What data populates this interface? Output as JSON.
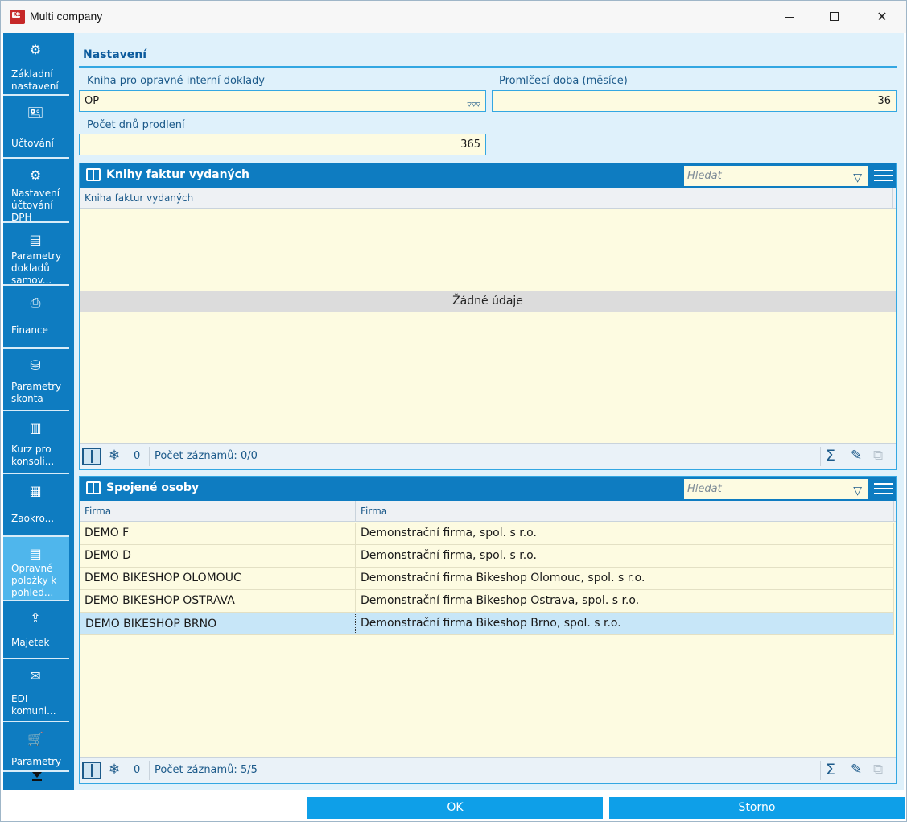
{
  "window": {
    "title": "Multi company",
    "app_icon": "K2"
  },
  "sidebar": {
    "items": [
      {
        "icon": "gear-icon",
        "glyph": "⚙",
        "label": "Základní nastavení"
      },
      {
        "icon": "accounting-icon",
        "glyph": "🖭",
        "label": "Účtování"
      },
      {
        "icon": "vat-settings-icon",
        "glyph": "⚙",
        "label": "Nastavení účtování DPH"
      },
      {
        "icon": "document-icon",
        "glyph": "▤",
        "label": "Parametry dokladů samov..."
      },
      {
        "icon": "printer-icon",
        "glyph": "⎙",
        "label": "Finance"
      },
      {
        "icon": "coins-icon",
        "glyph": "⛁",
        "label": "Parametry skonta"
      },
      {
        "icon": "chart-doc-icon",
        "glyph": "▥",
        "label": "Kurz pro konsoli..."
      },
      {
        "icon": "calculator-icon",
        "glyph": "▦",
        "label": "Zaokro..."
      },
      {
        "icon": "correction-doc-icon",
        "glyph": "▤",
        "label": "Opravné položky k pohled..."
      },
      {
        "icon": "asset-icon",
        "glyph": "⇪",
        "label": "Majetek"
      },
      {
        "icon": "mail-gear-icon",
        "glyph": "✉",
        "label": "EDI komuni..."
      },
      {
        "icon": "cart-icon",
        "glyph": "🛒",
        "label": "Parametry"
      }
    ]
  },
  "section": {
    "title": "Nastavení"
  },
  "form": {
    "book_label": "Kniha pro opravné interní doklady",
    "book_value": "OP",
    "period_label": "Promlčecí doba (měsíce)",
    "period_value": "36",
    "days_label": "Počet dnů prodlení",
    "days_value": "365"
  },
  "panel1": {
    "title": "Knihy faktur vydaných",
    "search_placeholder": "Hledat",
    "column": "Kniha faktur vydaných",
    "empty": "Žádné údaje",
    "count": "0",
    "records": "Počet záznamů: 0/0"
  },
  "panel2": {
    "title": "Spojené osoby",
    "search_placeholder": "Hledat",
    "columns": [
      "Firma",
      "Firma"
    ],
    "rows": [
      [
        "DEMO F",
        "Demonstrační firma, spol. s r.o."
      ],
      [
        "DEMO D",
        "Demonstrační firma, spol. s r.o."
      ],
      [
        "DEMO BIKESHOP OLOMOUC",
        "Demonstrační firma Bikeshop Olomouc, spol. s r.o."
      ],
      [
        "DEMO BIKESHOP OSTRAVA",
        "Demonstrační firma Bikeshop Ostrava, spol. s r.o."
      ],
      [
        "DEMO BIKESHOP BRNO",
        "Demonstrační firma Bikeshop Brno, spol. s r.o."
      ]
    ],
    "selected_row": 4,
    "count": "0",
    "records": "Počet záznamů: 5/5"
  },
  "buttons": {
    "ok": "OK",
    "cancel": "Storno"
  },
  "colors": {
    "accent": "#0e7cc1",
    "active": "#4fb6ec",
    "field_bg": "#fdfbe1",
    "selected": "#c7e6f8"
  }
}
